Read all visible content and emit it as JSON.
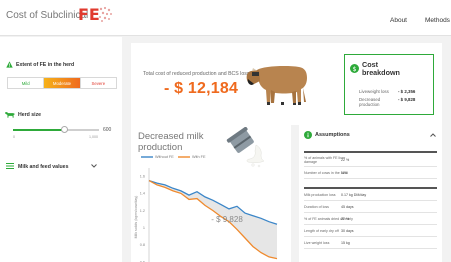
{
  "header": {
    "title": "Cost of Subclinical",
    "title_highlight": "FE",
    "nav": [
      "About",
      "Methods"
    ]
  },
  "sidebar": {
    "extent_title": "Extent of FE in the herd",
    "severity_options": [
      "Mild",
      "Moderate",
      "Severe"
    ],
    "selected_severity": "Moderate",
    "herd_size_title": "Herd size",
    "herd_size_value": "600",
    "herd_size_min": "0",
    "herd_size_max": "1,000",
    "herd_size_fraction": 0.6,
    "milk_feed_title": "Milk and feed values"
  },
  "cost": {
    "total_label": "Total cost of reduced production and BCS loss",
    "total_value": "- $ 12,184",
    "breakdown_title": "Cost breakdown",
    "breakdown_title_lines": [
      "Cost",
      "breakdown"
    ],
    "rows": [
      {
        "label": "Liveweight loss",
        "label_lines": [
          "Liveweight loss"
        ],
        "value": "- $ 2,356"
      },
      {
        "label": "Decreased production",
        "label_lines": [
          "Decreased",
          "production"
        ],
        "value": "- $ 9,828"
      }
    ]
  },
  "milk_chart": {
    "title": "Decreased milk production",
    "title_lines": [
      "Decreased milk",
      "production"
    ],
    "annotation": "- $ 9,828"
  },
  "chart_data": {
    "type": "line",
    "title": "Decreased milk production",
    "xlabel": "",
    "ylabel": "Milk solids (kgms/cow/day)",
    "y_ticks": [
      "1.6",
      "1.4",
      "1.2",
      "1",
      "0.8",
      "0.6"
    ],
    "ylim": [
      0.6,
      1.65
    ],
    "x": [
      0,
      1,
      2,
      3,
      4,
      5,
      6,
      7,
      8,
      9,
      10,
      11,
      12,
      13,
      14,
      15,
      16
    ],
    "series": [
      {
        "name": "Without FE",
        "color": "#3b86c8",
        "values": [
          1.55,
          1.52,
          1.5,
          1.46,
          1.43,
          1.38,
          1.42,
          1.36,
          1.32,
          1.27,
          1.22,
          1.25,
          1.17,
          1.14,
          1.11,
          1.07,
          1.04
        ]
      },
      {
        "name": "With FE",
        "color": "#ef8a2e",
        "values": [
          1.55,
          1.5,
          1.47,
          1.43,
          1.4,
          1.33,
          1.34,
          1.26,
          1.2,
          1.13,
          1.07,
          0.98,
          0.88,
          0.78,
          0.71,
          0.66,
          0.64
        ]
      }
    ],
    "grid": false,
    "legend": "top-left"
  },
  "assumptions": {
    "title": "Assumptions",
    "group1": [
      {
        "label": "% of animals with FE liver damage",
        "label_lines": [
          "% of animals with FE liver",
          "damage"
        ],
        "value": "22 %"
      },
      {
        "label": "Number of cows in the herd",
        "label_lines": [
          "Number of cows in the herd"
        ],
        "value": "120"
      }
    ],
    "group2": [
      {
        "label": "Milk production loss",
        "label_lines": [
          "Milk production loss"
        ],
        "value": "0.17 kg DM/day"
      },
      {
        "label": "Duration of loss",
        "label_lines": [
          "Duration of loss"
        ],
        "value": "45 days"
      },
      {
        "label": "% of FE animals dried off early",
        "label_lines": [
          "% of FE animals dried off early"
        ],
        "value": "22 %"
      },
      {
        "label": "Length of early dry off",
        "label_lines": [
          "Length of early dry off"
        ],
        "value": "30 days"
      },
      {
        "label": "Live weight loss",
        "label_lines": [
          "Live weight loss"
        ],
        "value": "15 kg"
      }
    ]
  },
  "colors": {
    "accent_green": "#2eaa3a",
    "accent_orange": "#ef6a1e",
    "brand_red": "#e03a2e",
    "line_blue": "#3b86c8"
  },
  "icons": [
    "warning-icon",
    "cow-icon",
    "list-icon",
    "chevron-down-icon",
    "chevron-up-icon",
    "dollar-icon",
    "info-icon"
  ]
}
